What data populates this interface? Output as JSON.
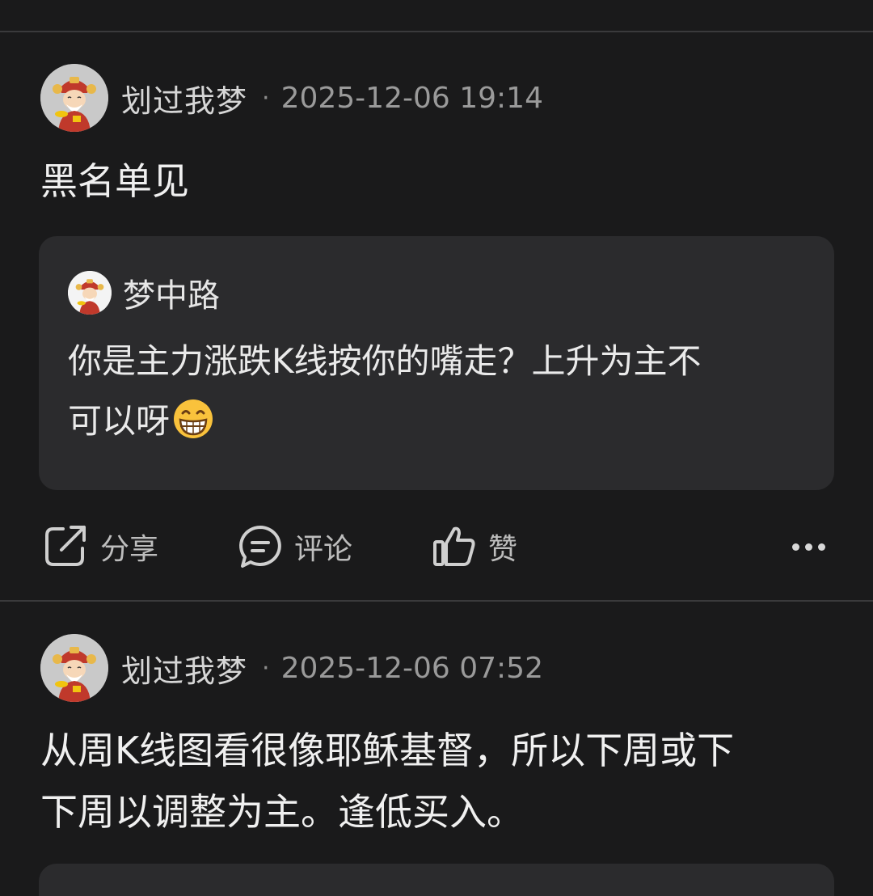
{
  "posts": [
    {
      "username": "划过我梦",
      "separator": "·",
      "timestamp": "2025-12-06 19:14",
      "content": "黑名单见",
      "quote": {
        "author": "梦中路",
        "text_line1": "你是主力涨跌K线按你的嘴走？上升为主不",
        "text_line2": "可以呀",
        "emoji": "grinning-face-icon"
      },
      "actions": {
        "share": "分享",
        "comment": "评论",
        "like": "赞",
        "more": "more-icon"
      }
    },
    {
      "username": "划过我梦",
      "separator": "·",
      "timestamp": "2025-12-06 07:52",
      "content_line1": "从周K线图看很像耶稣基督，所以下周或下",
      "content_line2": "下周以调整为主。逢低买入。"
    }
  ],
  "colors": {
    "background": "#1a1a1b",
    "card": "#2b2b2d",
    "divider": "#3a3a3c",
    "text_primary": "#f0f0f0",
    "text_secondary": "#9a9a9a"
  }
}
